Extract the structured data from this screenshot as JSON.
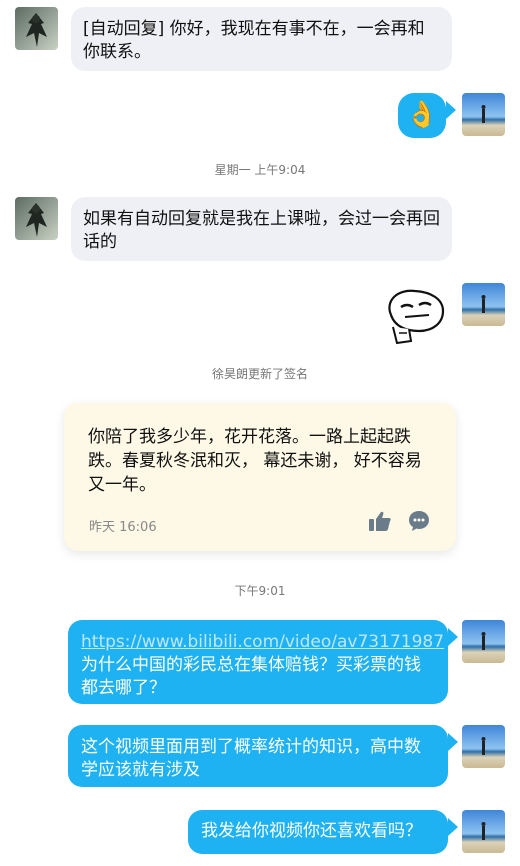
{
  "messages": {
    "m1": "[自动回复] 你好，我现在有事不在，一会再和你联系。",
    "m2_emoji": "👌",
    "time1": "星期一 上午9:04",
    "m3": "如果有自动回复就是我在上课啦，会过一会再回话的",
    "m4_sticker": "ok-hand-sticker",
    "sys_signature": "徐昊朗更新了签名",
    "signature_card": {
      "text": "你陪了我多少年，花开花落。一路上起起跌跌。春夏秋冬泯和灭， 幕还未谢， 好不容易又一年。",
      "time": "昨天 16:06"
    },
    "time2": "下午9:01",
    "m5_link": "https://www.bilibili.com/video/av73171987",
    "m5_text": "为什么中国的彩民总在集体赔钱？买彩票的钱都去哪了？",
    "m6": "这个视频里面用到了概率统计的知识，高中数学应该就有涉及",
    "m7": "我发给你视频你还喜欢看吗？"
  },
  "icons": {
    "like": "thumbs-up-icon",
    "comment": "comment-icon"
  },
  "colors": {
    "outgoing_bubble": "#1fb2f2",
    "incoming_bubble": "#eef0f5",
    "card_bg": "#fdf9e6"
  }
}
